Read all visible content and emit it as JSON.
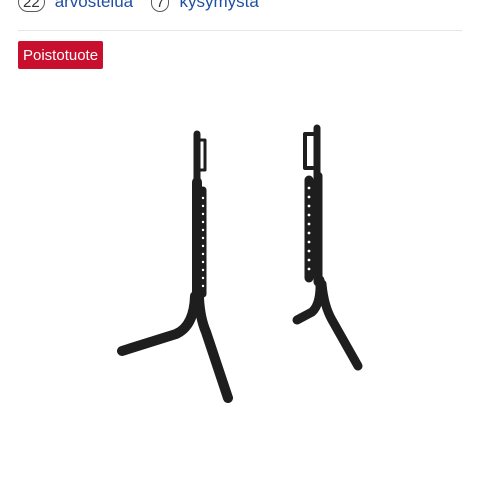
{
  "meta": {
    "reviews": {
      "count": "22",
      "label": "arvostelua"
    },
    "questions": {
      "count": "7",
      "label": "kysymystä"
    }
  },
  "badge": {
    "label": "Poistotuote",
    "color": "#c8102e"
  },
  "product_image": {
    "subject": "pair of tv-stand-legs",
    "color": "#1e1e1e"
  }
}
